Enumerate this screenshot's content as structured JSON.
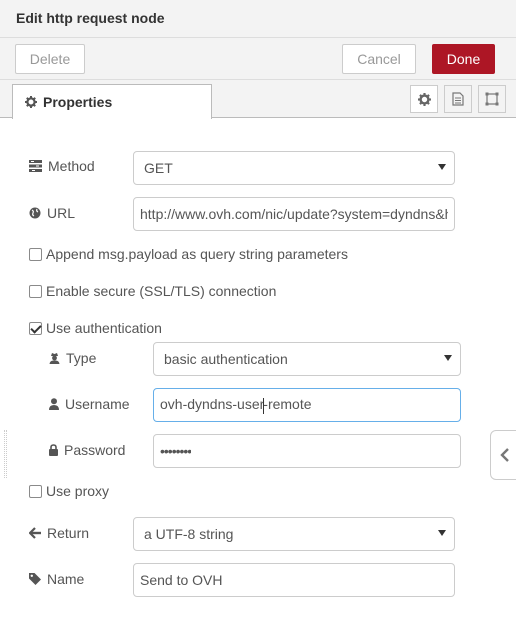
{
  "header": {
    "title": "Edit http request node"
  },
  "toolbar": {
    "delete_label": "Delete",
    "cancel_label": "Cancel",
    "done_label": "Done"
  },
  "tabs": {
    "properties_label": "Properties"
  },
  "form": {
    "method": {
      "label": "Method",
      "value": "GET"
    },
    "url": {
      "label": "URL",
      "value": "http://www.ovh.com/nic/update?system=dyndns&hostname={{{msg.hostname}}}"
    },
    "append_payload": {
      "label": "Append msg.payload as query string parameters",
      "checked": false
    },
    "secure": {
      "label": "Enable secure (SSL/TLS) connection",
      "checked": false
    },
    "use_auth": {
      "label": "Use authentication",
      "checked": true
    },
    "auth_type": {
      "label": "Type",
      "value": "basic authentication"
    },
    "username": {
      "label": "Username",
      "value_before_caret": "ovh-dyndns-user",
      "value_after_caret": "-remote"
    },
    "password": {
      "label": "Password",
      "value": "••••••••"
    },
    "use_proxy": {
      "label": "Use proxy",
      "checked": false
    },
    "return": {
      "label": "Return",
      "value": "a UTF-8 string"
    },
    "name": {
      "label": "Name",
      "value": "Send to OVH"
    }
  },
  "colors": {
    "done_button": "#ad1625",
    "focus_border": "#66afe9"
  }
}
